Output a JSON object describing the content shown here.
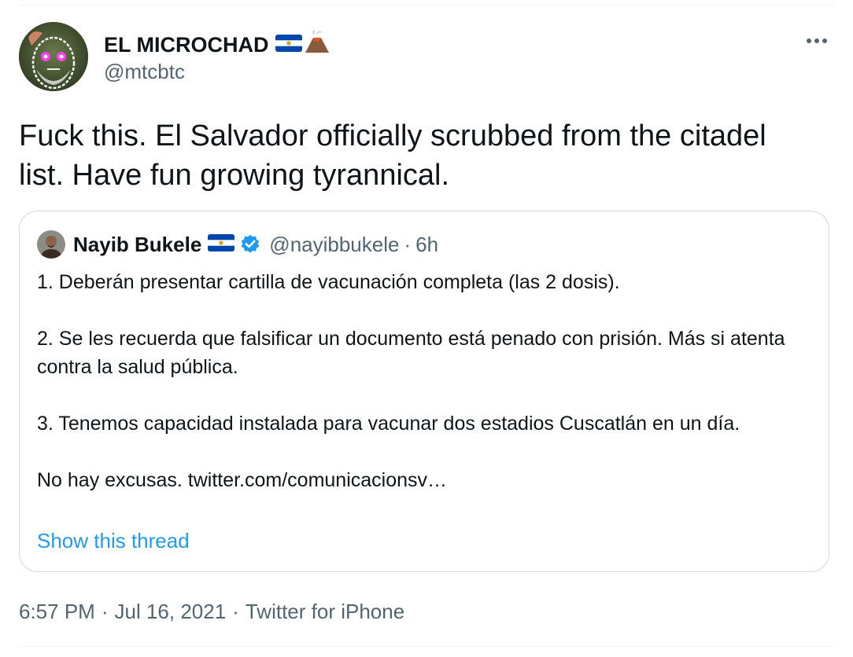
{
  "author": {
    "name": "EL MICROCHAD",
    "handle": "@mtcbtc",
    "badges": [
      "el-salvador-flag-icon",
      "volcano-icon"
    ]
  },
  "tweet": {
    "text_line1": "Fuck this. El Salvador officially scrubbed from the citadel",
    "text_line2": "list. Have fun growing tyrannical.",
    "more_icon": "more-horizontal-icon"
  },
  "quoted": {
    "name": "Nayib Bukele",
    "handle": "@nayibbukele",
    "separator": "·",
    "time": "6h",
    "badges": [
      "el-salvador-flag-icon",
      "verified-badge-icon"
    ],
    "paragraphs": [
      "1. Deberán presentar cartilla de vacunación completa (las 2 dosis).",
      "2. Se les recuerda que falsificar un documento está penado con prisión. Más si atenta contra la salud pública.",
      "3. Tenemos capacidad instalada para vacunar dos estadios Cuscatlán en un día.",
      "No hay excusas. twitter.com/comunicacionsv…"
    ],
    "show_thread_label": "Show this thread"
  },
  "meta": {
    "time": "6:57 PM",
    "separator": "·",
    "date": "Jul 16, 2021",
    "source": "Twitter for iPhone"
  },
  "colors": {
    "text": "#0f1419",
    "secondary": "#536471",
    "accent": "#1d9bf0",
    "border": "#cfd9de"
  }
}
